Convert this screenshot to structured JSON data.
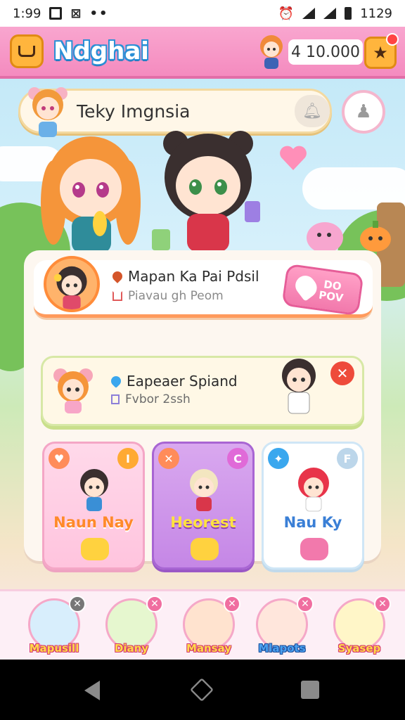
{
  "status_bar": {
    "time": "1:99",
    "clock_right": "1129"
  },
  "top_bar": {
    "title": "Ndghai",
    "currency": "4 10.000"
  },
  "player": {
    "name": "Teky Imgnsia"
  },
  "quests": [
    {
      "title": "Mapan Ka Pai Pdsil",
      "subtitle": "Piavau gh Peom",
      "action_label": "DO POV"
    },
    {
      "title": "Eapeaer Spiand",
      "subtitle": "Fvbor 2ssh"
    }
  ],
  "cards": [
    {
      "name": "Naun Nay",
      "badge": "I"
    },
    {
      "name": "Heorest",
      "badge": "C"
    },
    {
      "name": "Nau Ky",
      "badge": "F"
    }
  ],
  "roster": [
    {
      "name": "Mapusill"
    },
    {
      "name": "Diany"
    },
    {
      "name": "Mansay"
    },
    {
      "name": "Mlapots"
    },
    {
      "name": "Syasep"
    }
  ],
  "colors": {
    "accent_pink": "#f48bbf",
    "title_blue": "#2a8fd6",
    "orange": "#ffb53d"
  }
}
